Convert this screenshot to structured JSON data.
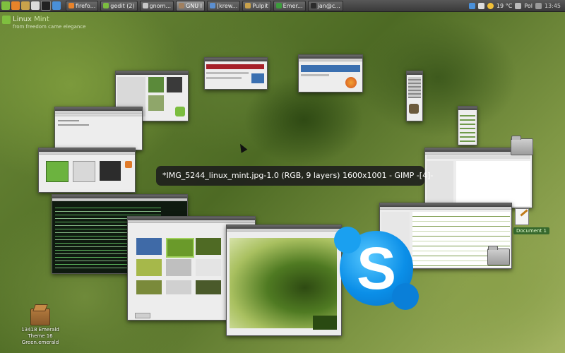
{
  "panel": {
    "tasks": [
      {
        "label": "firefo...",
        "color": "#e8832a",
        "active": false
      },
      {
        "label": "gedit (2)",
        "color": "#7bbd3f",
        "active": false
      },
      {
        "label": "gnom...",
        "color": "#c8c8c8",
        "active": false
      },
      {
        "label": "GNU I",
        "color": "#a08060",
        "active": true
      },
      {
        "label": "[krew...",
        "color": "#5b8fd0",
        "active": false
      },
      {
        "label": "Pulpit",
        "color": "#c9a24b",
        "active": false
      },
      {
        "label": "Emer...",
        "color": "#3c9c3c",
        "active": false
      },
      {
        "label": "jan@c...",
        "color": "#2b2b2b",
        "active": false
      }
    ],
    "tray": {
      "weather": "19 °C",
      "keyboard_layout": "Pol",
      "clock": "13:45"
    }
  },
  "branding": {
    "name_a": "Linux",
    "name_b": "Mint",
    "tagline": "from freedom came elegance"
  },
  "active_window_title": "*IMG_5244_linux_mint.jpg-1.0 (RGB, 9 layers) 1600x1001 - GIMP -[4]-",
  "desktop_icons": {
    "deb_package_label": "13418 Emerald Theme 16 Green.emerald",
    "document_label": "Document 1"
  },
  "colors": {
    "mint_green": "#7fbf3f",
    "skype_blue": "#0b8fe8",
    "panel_dark": "#3a3a3a"
  }
}
